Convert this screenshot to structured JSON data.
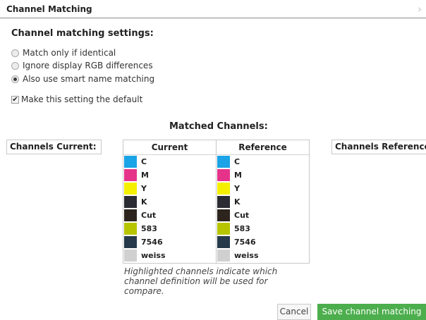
{
  "header": {
    "title": "Channel Matching",
    "chevron": "›"
  },
  "settings": {
    "title": "Channel matching settings:",
    "options": [
      {
        "label": "Match only if identical",
        "checked": false
      },
      {
        "label": "Ignore display RGB differences",
        "checked": false
      },
      {
        "label": "Also use smart name matching",
        "checked": true
      }
    ],
    "default_checkbox": {
      "label": "Make this setting the default",
      "checked": true,
      "mark": "✔"
    }
  },
  "matched": {
    "title": "Matched Channels:",
    "channels_current_label": "Channels Current:",
    "channels_reference_label": "Channels Reference:",
    "current": {
      "header": "Current",
      "rows": [
        {
          "label": "C",
          "color": "#1aa3e6"
        },
        {
          "label": "M",
          "color": "#e6338a"
        },
        {
          "label": "Y",
          "color": "#f5ef00"
        },
        {
          "label": "K",
          "color": "#2b2b33"
        },
        {
          "label": "Cut",
          "color": "#2d251d"
        },
        {
          "label": "583",
          "color": "#b7c400"
        },
        {
          "label": "7546",
          "color": "#263a4b"
        },
        {
          "label": "weiss",
          "color": "#d0d0d0"
        }
      ]
    },
    "reference": {
      "header": "Reference",
      "rows": [
        {
          "label": "C",
          "color": "#1aa3e6"
        },
        {
          "label": "M",
          "color": "#e6338a"
        },
        {
          "label": "Y",
          "color": "#f5ef00"
        },
        {
          "label": "K",
          "color": "#2b2b33"
        },
        {
          "label": "Cut",
          "color": "#2d251d"
        },
        {
          "label": "583",
          "color": "#b7c400"
        },
        {
          "label": "7546",
          "color": "#263a4b"
        },
        {
          "label": "weiss",
          "color": "#d0d0d0"
        }
      ]
    },
    "note": "Highlighted channels indicate which channel definition will be used for compare."
  },
  "buttons": {
    "cancel": "Cancel",
    "save": "Save channel matching"
  },
  "colors": {
    "accent_green": "#4cae4c"
  }
}
